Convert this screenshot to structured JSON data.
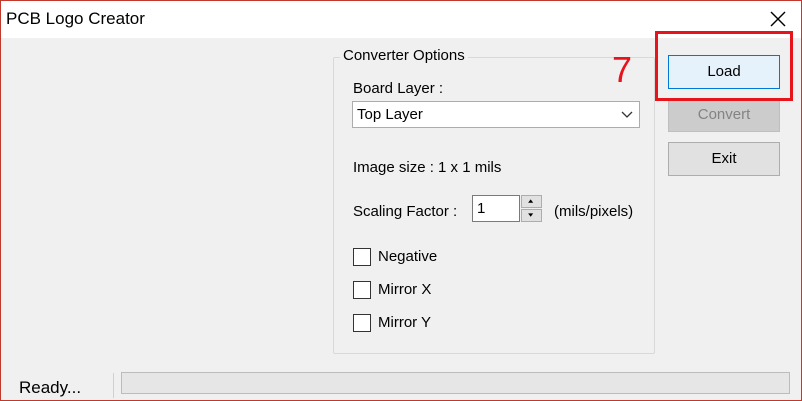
{
  "window": {
    "title": "PCB Logo Creator",
    "close_icon": "close-icon"
  },
  "converter_options": {
    "group_title": "Converter Options",
    "board_layer_label": "Board Layer :",
    "board_layer_value": "Top Layer",
    "image_size_text": "Image size : 1 x 1 mils",
    "scaling_factor_label": "Scaling Factor :",
    "scaling_factor_value": "1",
    "scaling_unit": "(mils/pixels)",
    "checkboxes": [
      {
        "label": "Negative",
        "checked": false
      },
      {
        "label": "Mirror X",
        "checked": false
      },
      {
        "label": "Mirror Y",
        "checked": false
      }
    ]
  },
  "buttons": {
    "load": "Load",
    "convert": "Convert",
    "exit": "Exit"
  },
  "annotation": {
    "step_number": "7",
    "color": "#e8141b"
  },
  "status": {
    "text": "Ready...",
    "progress": 0
  }
}
